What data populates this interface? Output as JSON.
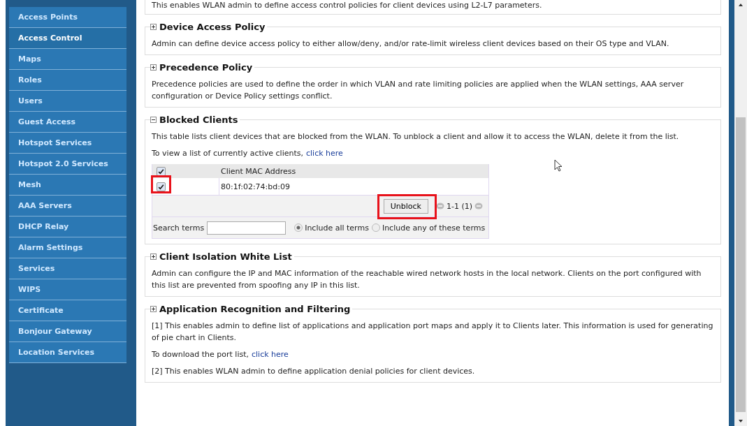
{
  "sidebar": {
    "items": [
      {
        "label": "Access Points",
        "selected": false
      },
      {
        "label": "Access Control",
        "selected": true
      },
      {
        "label": "Maps",
        "selected": false
      },
      {
        "label": "Roles",
        "selected": false
      },
      {
        "label": "Users",
        "selected": false
      },
      {
        "label": "Guest Access",
        "selected": false
      },
      {
        "label": "Hotspot Services",
        "selected": false
      },
      {
        "label": "Hotspot 2.0 Services",
        "selected": false
      },
      {
        "label": "Mesh",
        "selected": false
      },
      {
        "label": "AAA Servers",
        "selected": false
      },
      {
        "label": "DHCP Relay",
        "selected": false
      },
      {
        "label": "Alarm Settings",
        "selected": false
      },
      {
        "label": "Services",
        "selected": false
      },
      {
        "label": "WIPS",
        "selected": false
      },
      {
        "label": "Certificate",
        "selected": false
      },
      {
        "label": "Bonjour Gateway",
        "selected": false
      },
      {
        "label": "Location Services",
        "selected": false
      }
    ]
  },
  "top_text": "This enables WLAN admin to define access control policies for client devices using L2-L7 parameters.",
  "sections": [
    {
      "title": "Device Access Policy",
      "expanded": false,
      "paragraphs": [
        {
          "text": "Admin can define device access policy to either allow/deny, and/or rate-limit wireless client devices based on their OS type and VLAN."
        }
      ]
    },
    {
      "title": "Precedence Policy",
      "expanded": false,
      "paragraphs": [
        {
          "text": "Precedence policies are used to define the order in which VLAN and rate limiting policies are applied when the WLAN settings, AAA server configuration or Device Policy settings conflict."
        }
      ]
    },
    {
      "title": "Blocked Clients",
      "expanded": true,
      "paragraphs": [
        {
          "text": "This table lists client devices that are blocked from the WLAN. To unblock a client and allow it to access the WLAN, delete it from the list."
        },
        {
          "text": "To view a list of currently active clients,",
          "link": "click here"
        }
      ],
      "table": {
        "header_checked": true,
        "column": "Client MAC Address",
        "rows": [
          {
            "mac": "80:1f:02:74:bd:09",
            "checked": true,
            "highlighted": true
          }
        ],
        "button": {
          "label": "Unblock",
          "highlighted": true
        },
        "pager": "1-1 (1)",
        "search": {
          "label": "Search terms",
          "options": [
            {
              "label": "Include all terms",
              "selected": true
            },
            {
              "label": "Include any of these terms",
              "selected": false
            }
          ]
        }
      }
    },
    {
      "title": "Client Isolation White List",
      "expanded": false,
      "paragraphs": [
        {
          "text": "Admin can configure the IP and MAC information of the reachable wired network hosts in the local network. Clients on the port configured with this list are prevented from spoofing any IP in this list."
        }
      ]
    },
    {
      "title": "Application Recognition and Filtering",
      "expanded": false,
      "paragraphs": [
        {
          "text": "[1] This enables admin to define list of applications and application port maps and apply it to Clients later. This information is used for generating of pie chart in Clients."
        },
        {
          "text": "To download the port list,",
          "link": "click here"
        },
        {
          "text": "[2] This enables WLAN admin to define application denial policies for client devices."
        }
      ]
    }
  ]
}
